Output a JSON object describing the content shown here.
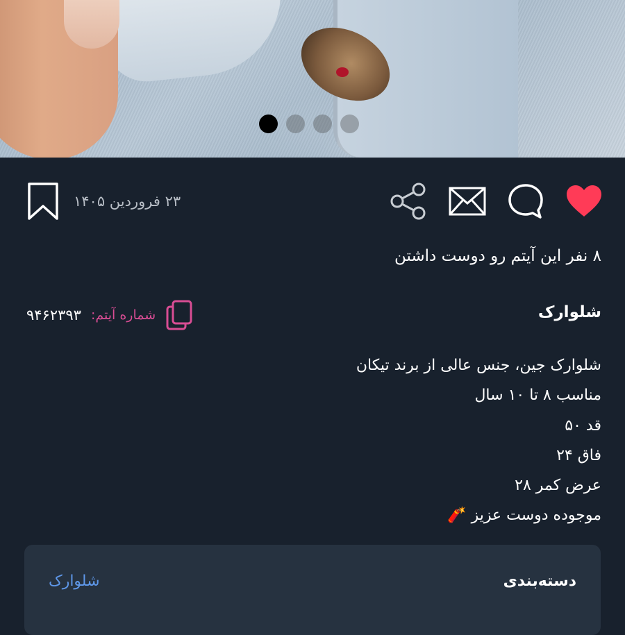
{
  "gallery": {
    "image_count": 4,
    "active_index": 0
  },
  "actions": {
    "like_icon": "heart-icon",
    "comment_icon": "comment-icon",
    "message_icon": "envelope-icon",
    "share_icon": "share-icon",
    "bookmark_icon": "bookmark-icon",
    "like_color": "#ff3b57"
  },
  "post": {
    "date": "۲۳ فروردین ۱۴۰۵",
    "likes_text": "۸ نفر این آیتم رو دوست داشتن",
    "title": "شلوارک",
    "item_number_label": "شماره آیتم:",
    "item_number": "۹۴۶۲۳۹۳",
    "description": [
      "شلوارک جین، جنس عالی از برند تیکان",
      "مناسب ۸ تا ۱۰ سال",
      "قد ۵۰",
      "فاق ۲۴",
      "عرض کمر ۲۸",
      "موجوده دوست عزیز 🧨"
    ]
  },
  "category": {
    "label": "دسته‌بندی",
    "value": "شلوارک"
  },
  "colors": {
    "background": "#18212d",
    "card": "#263240",
    "accent_pink": "#d94d94",
    "link_blue": "#5e97e8"
  }
}
